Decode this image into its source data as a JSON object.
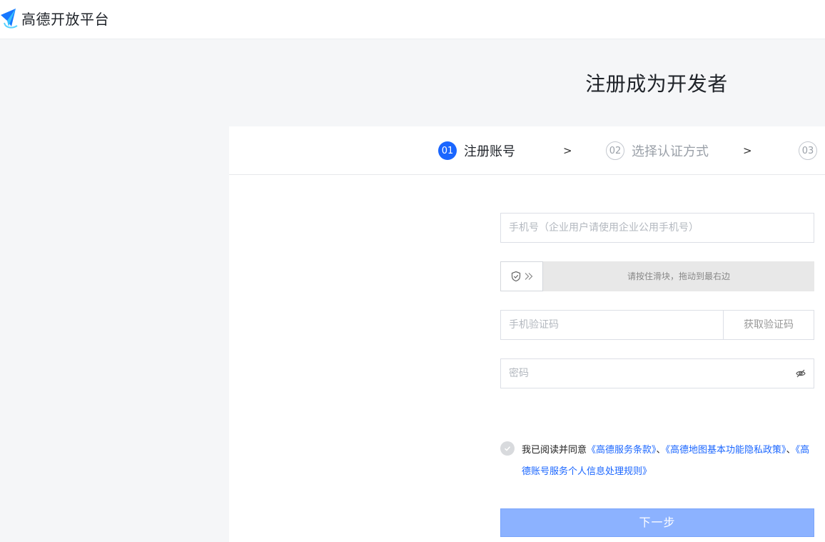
{
  "header": {
    "logo_text": "高德开放平台",
    "logo_icon": "paper-plane-logo-icon"
  },
  "page_title": "注册成为开发者",
  "steps": [
    {
      "num": "01",
      "label": "注册账号",
      "state": "active"
    },
    {
      "num": "02",
      "label": "选择认证方式",
      "state": "idle"
    },
    {
      "num": "03",
      "label": "",
      "state": "idle"
    }
  ],
  "step_separator": ">",
  "form": {
    "phone_placeholder": "手机号（企业用户请使用企业公用手机号）",
    "slider_text": "请按住滑块，拖动到最右边",
    "slider_icons": [
      "shield-check-icon",
      "double-chevron-right-icon"
    ],
    "sms_placeholder": "手机验证码",
    "get_code_label": "获取验证码",
    "password_placeholder": "密码",
    "password_icon": "eye-hidden-icon"
  },
  "agreement": {
    "prefix": "我已阅读并同意",
    "link1": "《高德服务条款》",
    "sep1": "、",
    "link2": "《高德地图基本功能隐私政策》",
    "sep2": "、",
    "link3": "《高德账号服务个人信息处理规则》",
    "checked": false
  },
  "next_label": "下一步",
  "colors": {
    "accent": "#1a66ff",
    "disabled_button": "#8cb2ff",
    "page_background": "#f5f6f8"
  }
}
